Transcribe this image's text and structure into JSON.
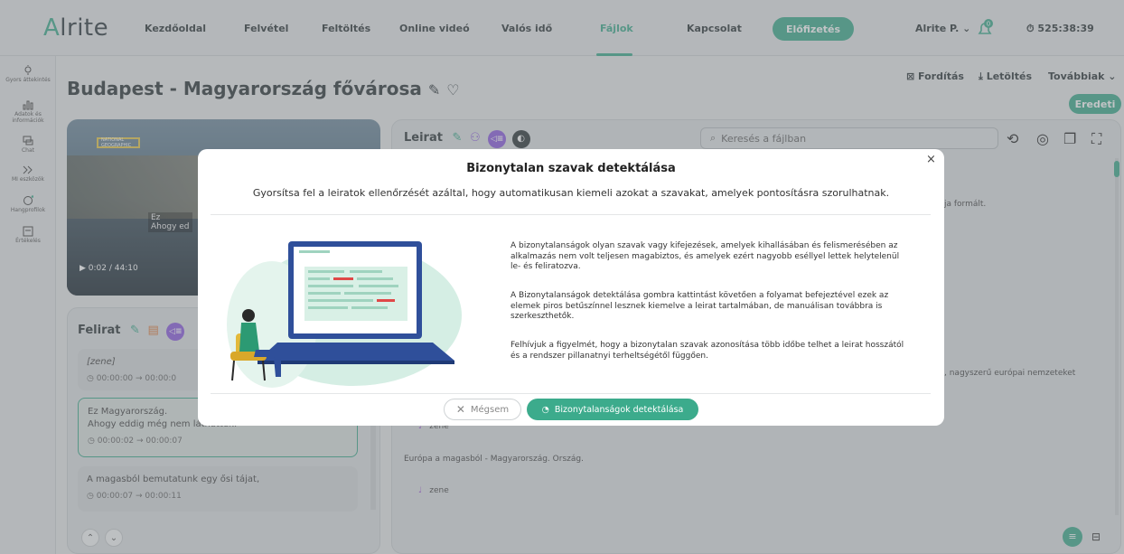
{
  "app": {
    "logo": "Alrite"
  },
  "nav": {
    "items": [
      "Kezdőoldal",
      "Felvétel",
      "Feltöltés",
      "Online videó",
      "Valós idő",
      "Fájlok",
      "Kapcsolat"
    ],
    "active": "Fájlok",
    "subscribe": "Előfizetés",
    "user": "Alrite P.",
    "notifications": "0",
    "timer": "525:38:39"
  },
  "sidebar": {
    "items": [
      {
        "label": "Gyors áttekintés",
        "icon": "lightbulb-icon"
      },
      {
        "label": "Adatok és információk",
        "icon": "chart-icon"
      },
      {
        "label": "Chat",
        "icon": "chat-icon"
      },
      {
        "label": "MI eszközök",
        "icon": "ai-tools-icon"
      },
      {
        "label": "Hangprofilok",
        "icon": "voice-profile-icon"
      },
      {
        "label": "Értékelés",
        "icon": "rating-icon"
      }
    ]
  },
  "page": {
    "title": "Budapest - Magyarország fővárosa",
    "toolbar": {
      "translate": "Fordítás",
      "download": "Letöltés",
      "more": "Továbbiak"
    },
    "eredeti": "Eredeti"
  },
  "video": {
    "brand": "NATIONAL GEOGRAPHIC",
    "time": "0:02 / 44:10",
    "subtitle_line1": "Ez",
    "subtitle_line2": "Ahogy ed"
  },
  "felirat": {
    "title": "Felirat",
    "segments": [
      {
        "text": "[zene]",
        "time": "00:00:00 → 00:00:0"
      },
      {
        "text": "Ez Magyarország.",
        "text2": "Ahogy eddig még nem láthattuk.",
        "time": "00:00:02 → 00:00:07"
      },
      {
        "text": "A magasból bemutatunk egy ősi tájat,",
        "time": "00:00:07 → 00:00:11"
      }
    ]
  },
  "leirat": {
    "title": "Leirat",
    "search_placeholder": "Keresés a fájlban",
    "lines": {
      "frag1": "ja formált.",
      "frag2": ", nagyszerű európai nemzeteket",
      "zene1": "zene",
      "europa": "Európa a magasból - Magyarország. Ország.",
      "zene2": "zene"
    }
  },
  "modal": {
    "title": "Bizonytalan szavak detektálása",
    "subtitle": "Gyorsítsa fel a leiratok ellenőrzését azáltal, hogy automatikusan kiemeli azokat a szavakat, amelyek pontosításra szorulhatnak.",
    "p1": "A bizonytalanságok olyan szavak vagy kifejezések, amelyek kihallásában és felismerésében az alkalmazás nem volt teljesen magabiztos, és amelyek ezért nagyobb eséllyel lettek helytelenül le- és feliratozva.",
    "p2": "A Bizonytalanságok detektálása gombra kattintást követően a folyamat befejeztével ezek az elemek piros betűszínnel lesznek kiemelve a leirat tartalmában, de manuálisan továbbra is szerkeszthetők.",
    "p3": "Felhívjuk a figyelmét, hogy a bizonytalan szavak azonosítása több időbe telhet a leirat hosszától és a rendszer pillanatnyi terheltségétől függően.",
    "cancel": "Mégsem",
    "detect": "Bizonytalanságok detektálása",
    "close": "×"
  },
  "colors": {
    "accent": "#3cab8c",
    "purple": "#8d5ce0",
    "dark": "#2d3538"
  }
}
